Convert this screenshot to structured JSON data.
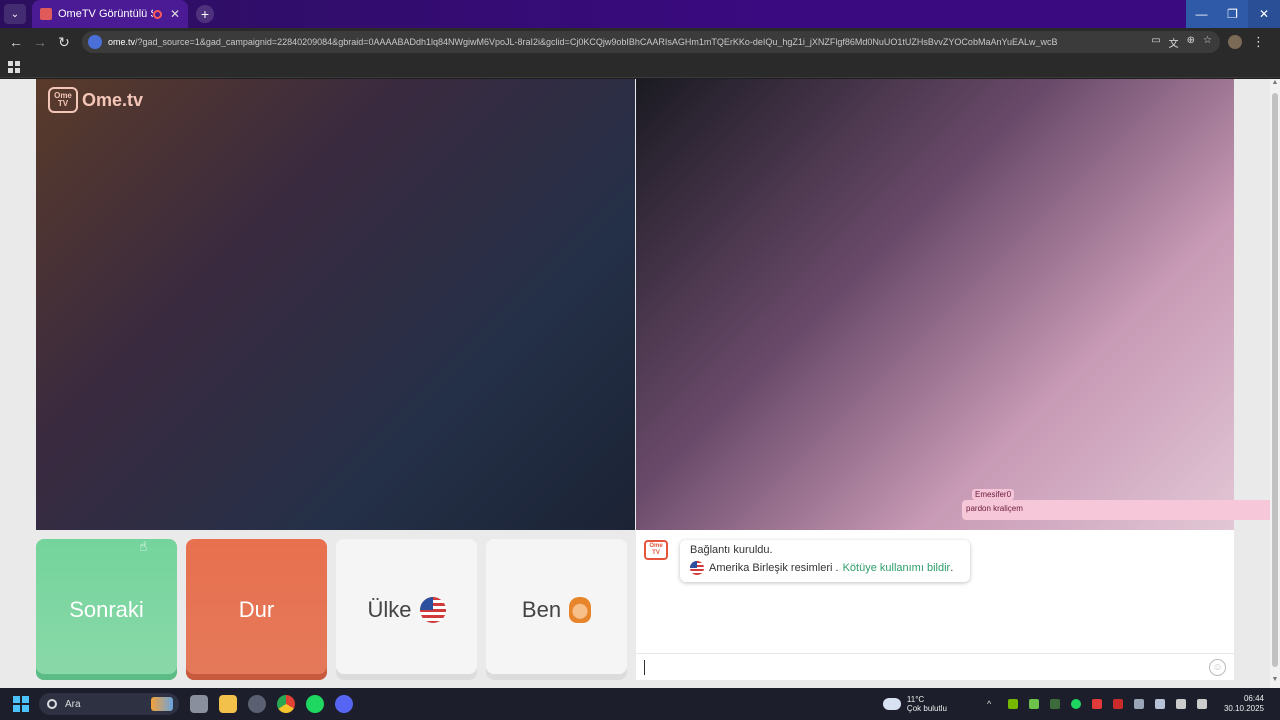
{
  "browser": {
    "tab_title": "OmeTV Görüntülü Sohbet -",
    "url_domain": "ome.tv",
    "url_rest": "/?gad_source=1&gad_campaignid=22840209084&gbraid=0AAAABADdh1lq84NWgiwM6VpoJL-8raI2i&gclid=Cj0KCQjw9obIBhCAARIsAGHm1mTQErKKo-deIQu_hgZ1i_jXNZFlgf86Md0NuUO1tUZHsBvvZYOCobMaAnYuEALw_wcB"
  },
  "video": {
    "logo_tv": "Ome TV",
    "logo_text": "Ome.tv",
    "overlay_name": "Emesifer0",
    "overlay_message": "pardon kraliçem"
  },
  "buttons": {
    "next": "Sonraki",
    "stop": "Dur",
    "country": "Ülke",
    "gender": "Ben"
  },
  "chat": {
    "connected": "Bağlantı kuruldu.",
    "country_line": "Amerika Birleşik resimleri .",
    "report": "Kötüye kullanımı bildir",
    "report_suffix": ".",
    "logo_text": "Ome TV"
  },
  "taskbar": {
    "search_label": "Ara",
    "temperature": "11°C",
    "weather_desc": "Çok bulutlu",
    "time": "06:44",
    "date": "30.10.2025"
  },
  "colors": {
    "next_button": "#74d49c",
    "stop_button": "#e8704f",
    "report_link": "#2e9e6b",
    "tabbar": "#3a0a80"
  }
}
